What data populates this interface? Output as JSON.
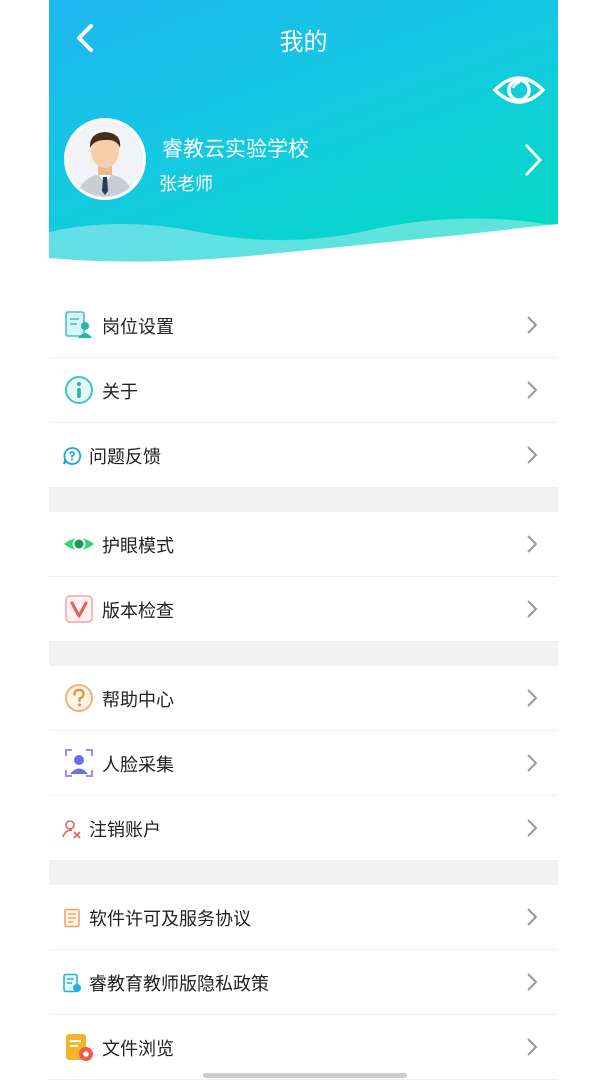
{
  "header": {
    "title": "我的",
    "school": "睿教云实验学校",
    "username": "张老师"
  },
  "menu": {
    "post_settings": "岗位设置",
    "about": "关于",
    "feedback": "问题反馈",
    "eye_mode": "护眼模式",
    "version_check": "版本检查",
    "help_center": "帮助中心",
    "face_collect": "人脸采集",
    "cancel_account": "注销账户",
    "license": "软件许可及服务协议",
    "privacy": "睿教育教师版隐私政策",
    "file_browse": "文件浏览"
  },
  "colors": {
    "header_start": "#1eb6f0",
    "header_end": "#00dcbd"
  }
}
